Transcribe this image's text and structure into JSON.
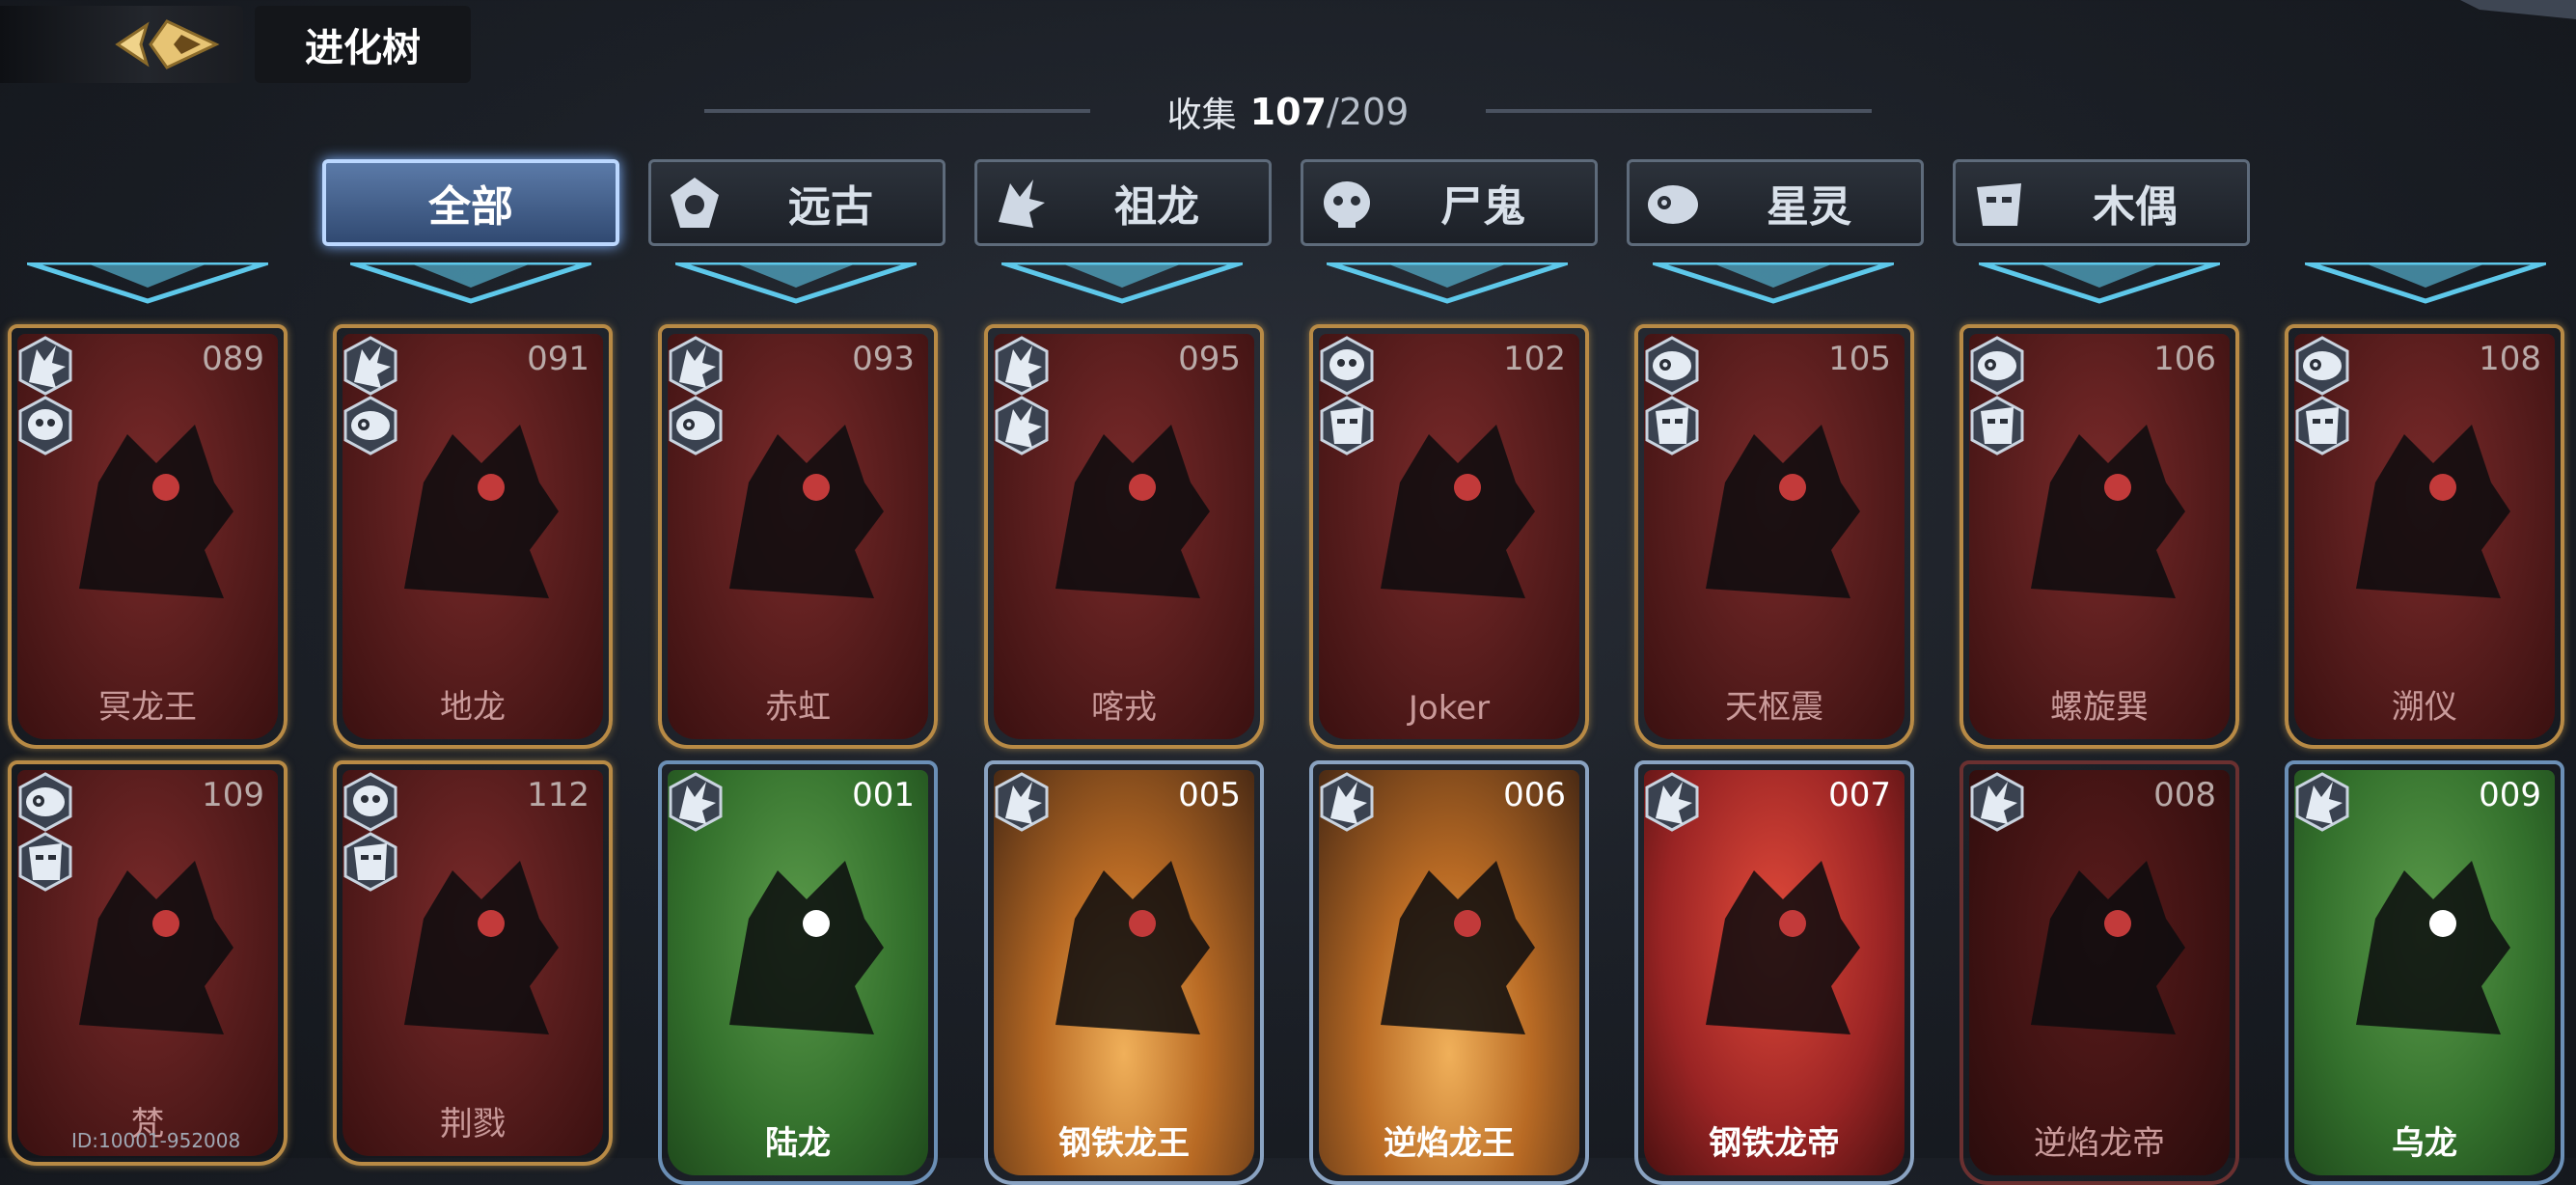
{
  "header": {
    "title": "进化树"
  },
  "collection": {
    "label": "收集",
    "collected": "107",
    "separator": "/",
    "total": "209"
  },
  "tabs": [
    {
      "label": "全部",
      "active": true,
      "icon": "none"
    },
    {
      "label": "远古",
      "active": false,
      "icon": "ancient-icon"
    },
    {
      "label": "祖龙",
      "active": false,
      "icon": "dragon-icon"
    },
    {
      "label": "尸鬼",
      "active": false,
      "icon": "ghoul-icon"
    },
    {
      "label": "星灵",
      "active": false,
      "icon": "star-spirit-icon"
    },
    {
      "label": "木偶",
      "active": false,
      "icon": "puppet-icon"
    }
  ],
  "cards": [
    {
      "number": "089",
      "name": "冥龙王",
      "style": "red",
      "badges": [
        "dragon-icon",
        "ghoul-icon"
      ]
    },
    {
      "number": "091",
      "name": "地龙",
      "style": "red",
      "badges": [
        "dragon-icon",
        "star-spirit-icon"
      ]
    },
    {
      "number": "093",
      "name": "赤虹",
      "style": "red",
      "badges": [
        "dragon-icon",
        "star-spirit-icon"
      ]
    },
    {
      "number": "095",
      "name": "喀戎",
      "style": "red",
      "badges": [
        "dragon-icon",
        "dragon-icon"
      ]
    },
    {
      "number": "102",
      "name": "Joker",
      "style": "red",
      "badges": [
        "ghoul-icon",
        "puppet-icon"
      ]
    },
    {
      "number": "105",
      "name": "天枢震",
      "style": "red",
      "badges": [
        "star-spirit-icon",
        "puppet-icon"
      ]
    },
    {
      "number": "106",
      "name": "螺旋巽",
      "style": "red",
      "badges": [
        "star-spirit-icon",
        "puppet-icon"
      ]
    },
    {
      "number": "108",
      "name": "溯仪",
      "style": "red",
      "badges": [
        "star-spirit-icon",
        "puppet-icon"
      ]
    },
    {
      "number": "109",
      "name": "梵",
      "style": "red",
      "badges": [
        "star-spirit-icon",
        "puppet-icon"
      ]
    },
    {
      "number": "112",
      "name": "荆戮",
      "style": "red",
      "badges": [
        "ghoul-icon",
        "puppet-icon"
      ]
    },
    {
      "number": "001",
      "name": "陆龙",
      "style": "green",
      "badges": [
        "dragon-icon"
      ]
    },
    {
      "number": "005",
      "name": "钢铁龙王",
      "style": "gold",
      "badges": [
        "dragon-icon"
      ]
    },
    {
      "number": "006",
      "name": "逆焰龙王",
      "style": "gold",
      "badges": [
        "dragon-icon"
      ]
    },
    {
      "number": "007",
      "name": "钢铁龙帝",
      "style": "crimson",
      "badges": [
        "dragon-icon"
      ]
    },
    {
      "number": "008",
      "name": "逆焰龙帝",
      "style": "darkred",
      "badges": [
        "dragon-icon"
      ]
    },
    {
      "number": "009",
      "name": "乌龙",
      "style": "green",
      "badges": [
        "dragon-icon"
      ]
    }
  ],
  "footer": {
    "player_id": "ID:10001-952008"
  },
  "colors": {
    "active_tab": "#4a6a9a",
    "card_gold_border": "#b88a45",
    "chevron": "#5ec8ea"
  }
}
